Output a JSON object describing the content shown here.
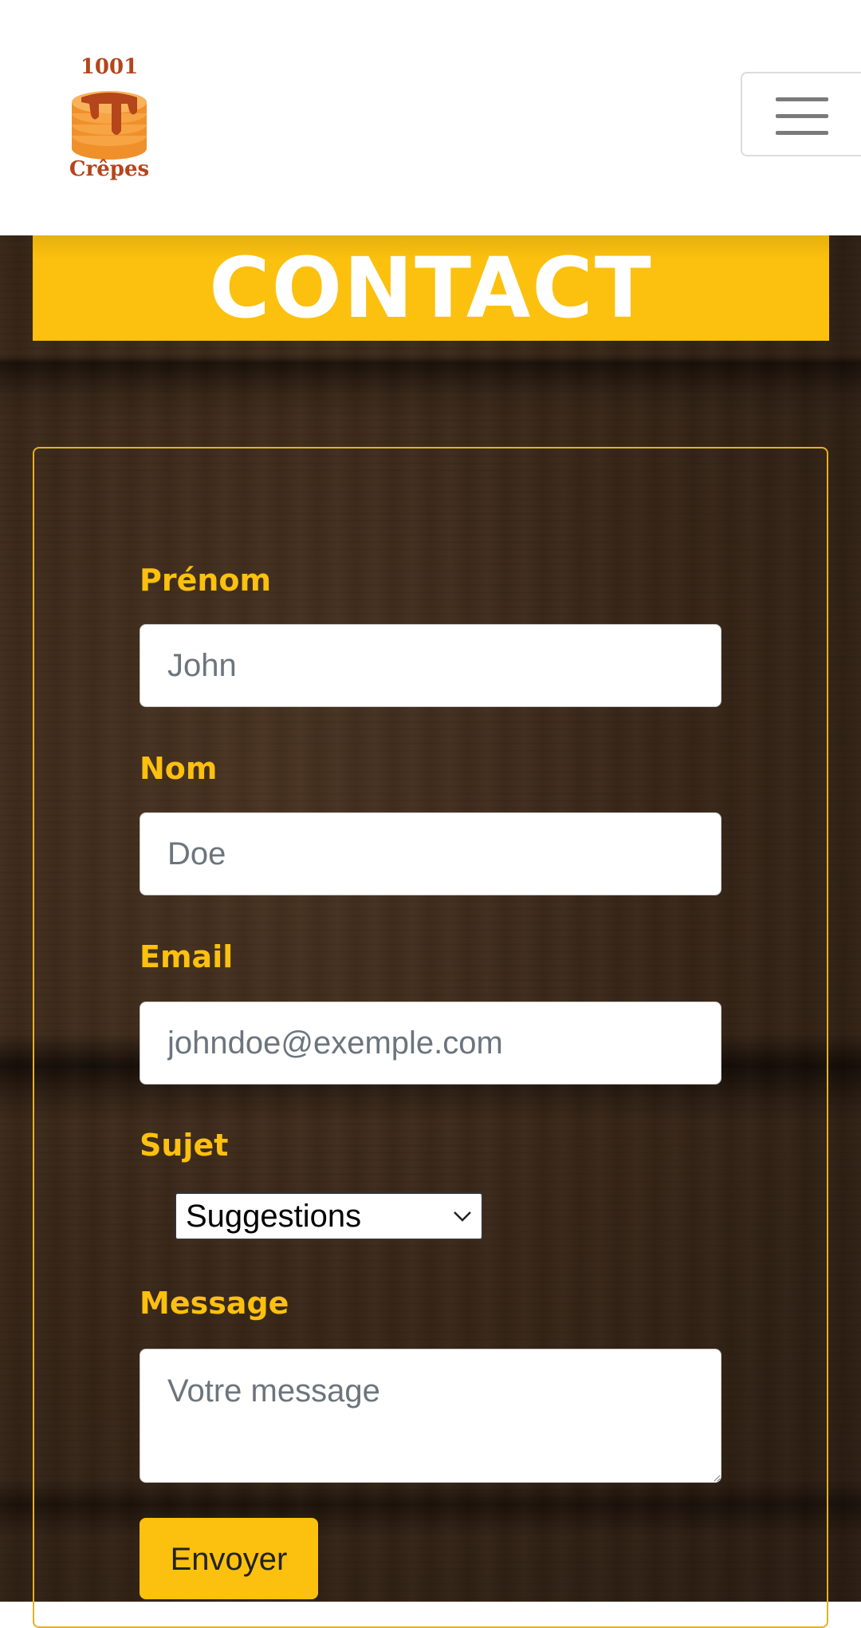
{
  "header": {
    "logo": {
      "number": "1001",
      "name": "Crêpes",
      "icon": "crepe-stack-icon"
    },
    "menu_icon": "hamburger-icon"
  },
  "banner": {
    "title": "CONTACT"
  },
  "form": {
    "first_name": {
      "label": "Prénom",
      "placeholder": "John"
    },
    "last_name": {
      "label": "Nom",
      "placeholder": "Doe"
    },
    "email": {
      "label": "Email",
      "placeholder": "johndoe@exemple.com"
    },
    "subject": {
      "label": "Sujet",
      "selected": "Suggestions"
    },
    "message": {
      "label": "Message",
      "placeholder": "Votre message"
    },
    "submit_label": "Envoyer"
  },
  "colors": {
    "accent": "#fcc00e",
    "logo_orange": "#f0902a",
    "logo_brown": "#b5451b"
  }
}
